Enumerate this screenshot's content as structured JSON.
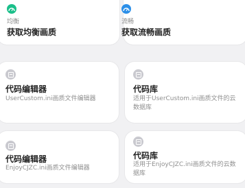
{
  "cards": {
    "balanced": {
      "tag": "均衡",
      "title": "获取均衡画质",
      "accent": "#1bbf8a"
    },
    "smooth": {
      "tag": "流畅",
      "title": "获取流畅画质",
      "accent": "#2c8fe8"
    },
    "editor_custom": {
      "title": "代码编辑器",
      "desc": "UserCustom.ini画质文件编辑器"
    },
    "library_custom": {
      "title": "代码库",
      "desc": "适用于UserCustom.ini画质文件的云数据库"
    },
    "editor_enjoy": {
      "title": "代码编辑器",
      "desc": "EnjoyCJZC.ini画质文件编辑器"
    },
    "library_enjoy": {
      "title": "代码库",
      "desc": "适用于EnjoyCJZC.ini画质文件的云数据库"
    }
  },
  "icons": {
    "balanced": "gauge-icon",
    "smooth": "gauge-icon",
    "editor": "code-file-icon",
    "library": "code-file-icon"
  }
}
